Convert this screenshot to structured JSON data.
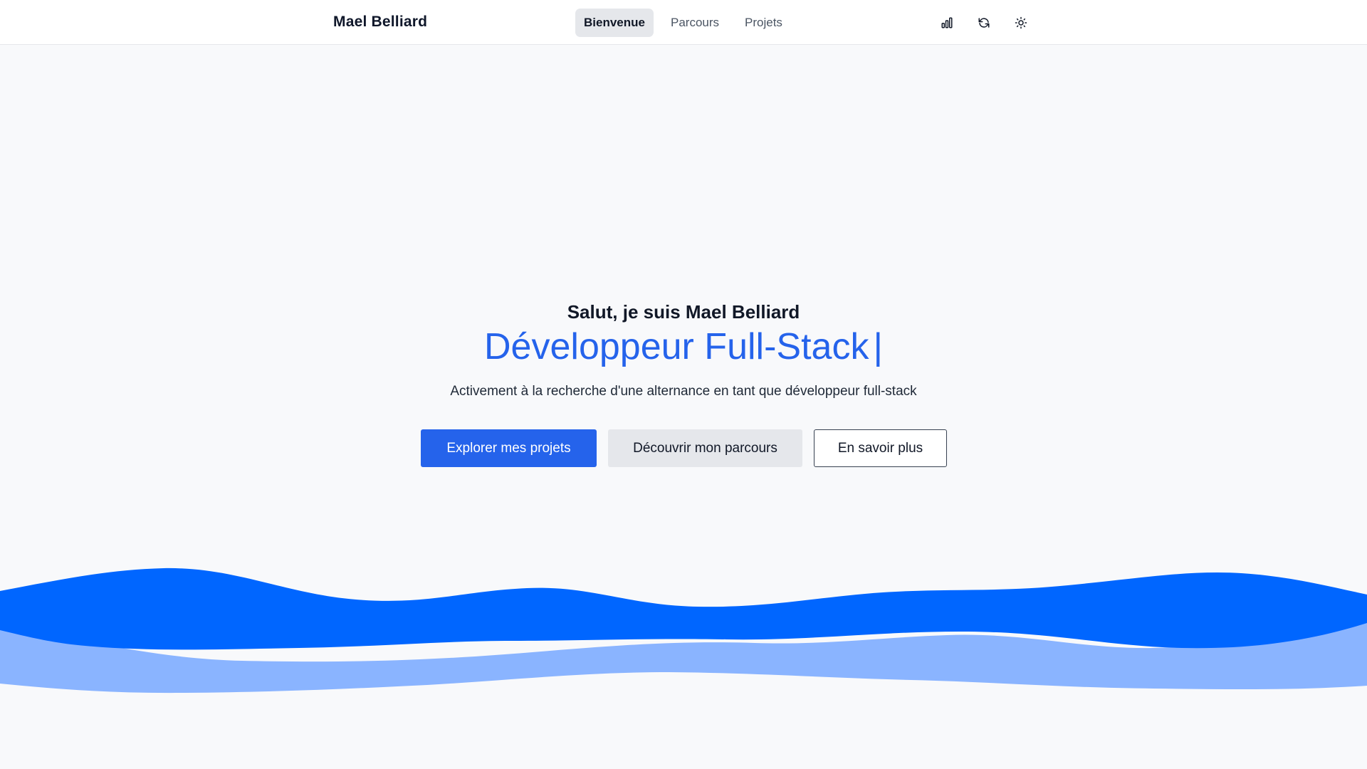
{
  "navbar": {
    "brand": "Mael Belliard",
    "links": [
      {
        "label": "Bienvenue",
        "active": true
      },
      {
        "label": "Parcours",
        "active": false
      },
      {
        "label": "Projets",
        "active": false
      }
    ],
    "icons": [
      "bar-chart-icon",
      "refresh-icon",
      "sun-icon"
    ]
  },
  "hero": {
    "greeting": "Salut, je suis Mael Belliard",
    "role": "Développeur Full-Stack",
    "cursor": "|",
    "subtitle": "Activement à la recherche d'une alternance en tant que développeur full-stack"
  },
  "cta": {
    "primary": "Explorer mes projets",
    "secondary": "Découvrir mon parcours",
    "outline": "En savoir plus"
  },
  "colors": {
    "accent": "#2563eb",
    "wave_front": "#0066ff",
    "wave_back": "#8ab4ff",
    "background": "#f8f9fb"
  }
}
